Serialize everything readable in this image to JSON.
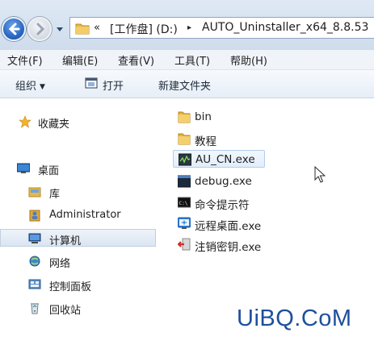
{
  "address_bar": {
    "chevron": "«",
    "drive": "[工作盘] (D:)",
    "separator": "▸",
    "folder": "AUTO_Uninstaller_x64_8.8.53"
  },
  "menu": [
    "文件(F)",
    "编辑(E)",
    "查看(V)",
    "工具(T)",
    "帮助(H)"
  ],
  "toolbar": {
    "organize": "组织",
    "open": "打开",
    "new_folder": "新建文件夹"
  },
  "nav": {
    "favorites": "收藏夹",
    "desktop": "桌面",
    "libraries": "库",
    "administrator": "Administrator",
    "computer": "计算机",
    "network": "网络",
    "control_panel": "控制面板",
    "recycle_bin": "回收站"
  },
  "files": [
    {
      "name": "bin",
      "icon": "folder-icon"
    },
    {
      "name": "教程",
      "icon": "folder-icon"
    },
    {
      "name": "AU_CN.exe",
      "icon": "app-exe-icon"
    },
    {
      "name": "debug.exe",
      "icon": "console-exe-icon"
    },
    {
      "name": "命令提示符",
      "icon": "cmd-icon"
    },
    {
      "name": "远程桌面.exe",
      "icon": "remote-desktop-icon"
    },
    {
      "name": "注销密钥.exe",
      "icon": "logoff-key-icon"
    }
  ],
  "watermark": "UiBQ.CoM",
  "colors": {
    "accent": "#2a67c4",
    "folder_yellow": "#e8b84a",
    "selection": "#dbe5f1",
    "watermark": "#1d4f9e"
  }
}
